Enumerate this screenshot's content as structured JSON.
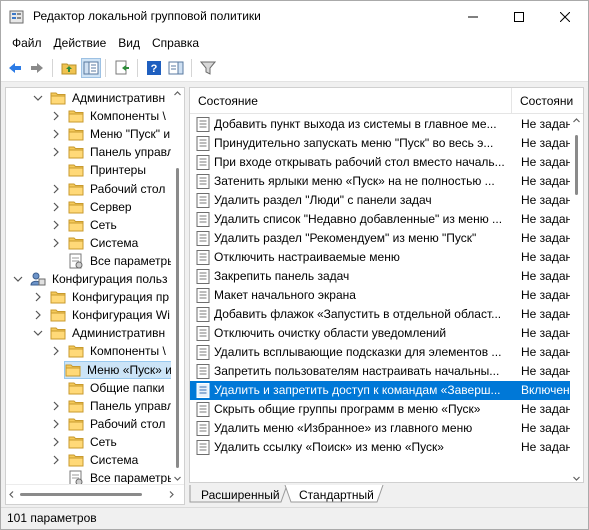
{
  "window": {
    "title": "Редактор локальной групповой политики"
  },
  "menu": [
    "Файл",
    "Действие",
    "Вид",
    "Справка"
  ],
  "toolbar": {
    "icons": [
      "back-arrow-icon",
      "forward-arrow-icon",
      "folder-up-icon",
      "show-hide-tree-icon",
      "export-list-icon",
      "help-icon",
      "properties-pane-icon",
      "filter-icon"
    ]
  },
  "tree": [
    {
      "label": "Административн",
      "level": 1,
      "chevron": "expanded",
      "icon": "folder"
    },
    {
      "label": "Компоненты \\",
      "level": 2,
      "chevron": "collapsed",
      "icon": "folder"
    },
    {
      "label": "Меню \"Пуск\" и",
      "level": 2,
      "chevron": "collapsed",
      "icon": "folder"
    },
    {
      "label": "Панель управл",
      "level": 2,
      "chevron": "collapsed",
      "icon": "folder"
    },
    {
      "label": "Принтеры",
      "level": 2,
      "chevron": "none",
      "icon": "folder"
    },
    {
      "label": "Рабочий стол",
      "level": 2,
      "chevron": "collapsed",
      "icon": "folder"
    },
    {
      "label": "Сервер",
      "level": 2,
      "chevron": "collapsed",
      "icon": "folder"
    },
    {
      "label": "Сеть",
      "level": 2,
      "chevron": "collapsed",
      "icon": "folder"
    },
    {
      "label": "Система",
      "level": 2,
      "chevron": "collapsed",
      "icon": "folder"
    },
    {
      "label": "Все параметры",
      "level": 2,
      "chevron": "none",
      "icon": "settings-folder"
    },
    {
      "label": "Конфигурация польз",
      "level": 0,
      "chevron": "expanded",
      "icon": "user-config"
    },
    {
      "label": "Конфигурация пр",
      "level": 1,
      "chevron": "collapsed",
      "icon": "folder"
    },
    {
      "label": "Конфигурация Wi",
      "level": 1,
      "chevron": "collapsed",
      "icon": "folder"
    },
    {
      "label": "Административн",
      "level": 1,
      "chevron": "expanded",
      "icon": "folder"
    },
    {
      "label": "Компоненты \\",
      "level": 2,
      "chevron": "collapsed",
      "icon": "folder"
    },
    {
      "label": "Меню «Пуск» и",
      "level": 2,
      "chevron": "none",
      "icon": "folder",
      "selected": true
    },
    {
      "label": "Общие папки",
      "level": 2,
      "chevron": "none",
      "icon": "folder"
    },
    {
      "label": "Панель управл",
      "level": 2,
      "chevron": "collapsed",
      "icon": "folder"
    },
    {
      "label": "Рабочий стол",
      "level": 2,
      "chevron": "collapsed",
      "icon": "folder"
    },
    {
      "label": "Сеть",
      "level": 2,
      "chevron": "collapsed",
      "icon": "folder"
    },
    {
      "label": "Система",
      "level": 2,
      "chevron": "collapsed",
      "icon": "folder"
    },
    {
      "label": "Все параметры",
      "level": 2,
      "chevron": "none",
      "icon": "settings-folder"
    }
  ],
  "list": {
    "columns": [
      "Состояние",
      "Состояни"
    ],
    "rows": [
      {
        "name": "Добавить пункт выхода из системы в главное ме...",
        "state": "Не задан"
      },
      {
        "name": "Принудительно запускать меню \"Пуск\" во весь э...",
        "state": "Не задан"
      },
      {
        "name": "При входе открывать рабочий стол вместо началь...",
        "state": "Не задан"
      },
      {
        "name": "Затенить ярлыки меню «Пуск» на не полностью ...",
        "state": "Не задан"
      },
      {
        "name": "Удалить раздел \"Люди\" с панели задач",
        "state": "Не задан"
      },
      {
        "name": "Удалить список \"Недавно добавленные\" из меню ...",
        "state": "Не задан"
      },
      {
        "name": "Удалить раздел \"Рекомендуем\" из меню \"Пуск\"",
        "state": "Не задан"
      },
      {
        "name": "Отключить настраиваемые меню",
        "state": "Не задан"
      },
      {
        "name": "Закрепить панель задач",
        "state": "Не задан"
      },
      {
        "name": "Макет начального экрана",
        "state": "Не задан"
      },
      {
        "name": "Добавить флажок «Запустить в отдельной област...",
        "state": "Не задан"
      },
      {
        "name": "Отключить очистку области уведомлений",
        "state": "Не задан"
      },
      {
        "name": "Удалить всплывающие подсказки для элементов ...",
        "state": "Не задан"
      },
      {
        "name": "Запретить пользователям настраивать начальны...",
        "state": "Не задан"
      },
      {
        "name": "Удалить и запретить доступ к командам «Заверш...",
        "state": "Включен",
        "selected": true
      },
      {
        "name": "Скрыть общие группы программ в меню «Пуск»",
        "state": "Не задан"
      },
      {
        "name": "Удалить меню «Избранное» из главного меню",
        "state": "Не задан"
      },
      {
        "name": "Удалить ссылку «Поиск» из меню «Пуск»",
        "state": "Не задан"
      }
    ]
  },
  "tabs": [
    "Расширенный",
    "Стандартный"
  ],
  "status": {
    "text": "101 параметров"
  }
}
